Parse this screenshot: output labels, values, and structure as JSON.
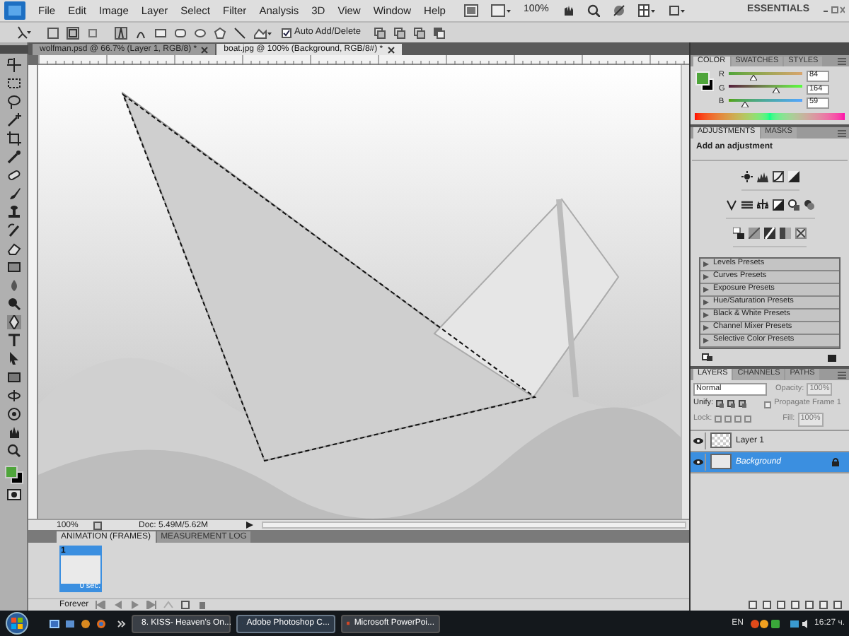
{
  "menu_bar": {
    "items": [
      "File",
      "Edit",
      "Image",
      "Layer",
      "Select",
      "Filter",
      "Analysis",
      "3D",
      "View",
      "Window",
      "Help"
    ],
    "zoom": "100%",
    "workspace": "ESSENTIALS"
  },
  "options_bar": {
    "auto_add_delete": {
      "label": "Auto Add/Delete",
      "checked": true
    }
  },
  "document_tabs": [
    {
      "label": "wolfman.psd @ 66.7% (Layer 1, RGB/8) *",
      "selected": false
    },
    {
      "label": "boat.jpg @ 100% (Background, RGB/8#) *",
      "selected": true
    }
  ],
  "status_bar": {
    "zoom": "100%",
    "doc": "Doc: 5.49M/5.62M"
  },
  "animation_panel": {
    "tabs": [
      {
        "label": "ANIMATION (FRAMES)",
        "selected": true
      },
      {
        "label": "MEASUREMENT LOG",
        "selected": false
      }
    ],
    "frames": [
      {
        "number": "1",
        "delay": "0 sec.",
        "selected": true
      }
    ],
    "loop": "Forever"
  },
  "color_panel": {
    "tabs": [
      {
        "label": "COLOR",
        "selected": true
      },
      {
        "label": "SWATCHES",
        "selected": false
      },
      {
        "label": "STYLES",
        "selected": false
      }
    ],
    "channels": [
      {
        "name": "R",
        "value": "84",
        "level": 0.33
      },
      {
        "name": "G",
        "value": "164",
        "level": 0.64
      },
      {
        "name": "B",
        "value": "59",
        "level": 0.23
      }
    ]
  },
  "adjustments_panel": {
    "tabs": [
      {
        "label": "ADJUSTMENTS",
        "selected": true
      },
      {
        "label": "MASKS",
        "selected": false
      }
    ],
    "heading": "Add an adjustment",
    "presets": [
      "Levels Presets",
      "Curves Presets",
      "Exposure Presets",
      "Hue/Saturation Presets",
      "Black & White Presets",
      "Channel Mixer Presets",
      "Selective Color Presets"
    ]
  },
  "layers_panel": {
    "tabs": [
      {
        "label": "LAYERS",
        "selected": true
      },
      {
        "label": "CHANNELS",
        "selected": false
      },
      {
        "label": "PATHS",
        "selected": false
      }
    ],
    "blend_mode": "Normal",
    "opacity_label": "Opacity:",
    "opacity": "100%",
    "unify_label": "Unify:",
    "propagate": {
      "label": "Propagate Frame 1",
      "checked": false
    },
    "lock_label": "Lock:",
    "fill_label": "Fill:",
    "fill": "100%",
    "layers": [
      {
        "name": "Layer 1",
        "visible": true,
        "selected": false,
        "locked": false
      },
      {
        "name": "Background",
        "visible": true,
        "selected": true,
        "locked": true
      }
    ]
  },
  "taskbar": {
    "tasks": [
      {
        "label": "8. KISS- Heaven's On...",
        "selected": false
      },
      {
        "label": "Adobe Photoshop C...",
        "selected": true
      },
      {
        "label": "Microsoft PowerPoi...",
        "selected": false
      }
    ],
    "language": "EN",
    "clock": "16:27 ч."
  }
}
